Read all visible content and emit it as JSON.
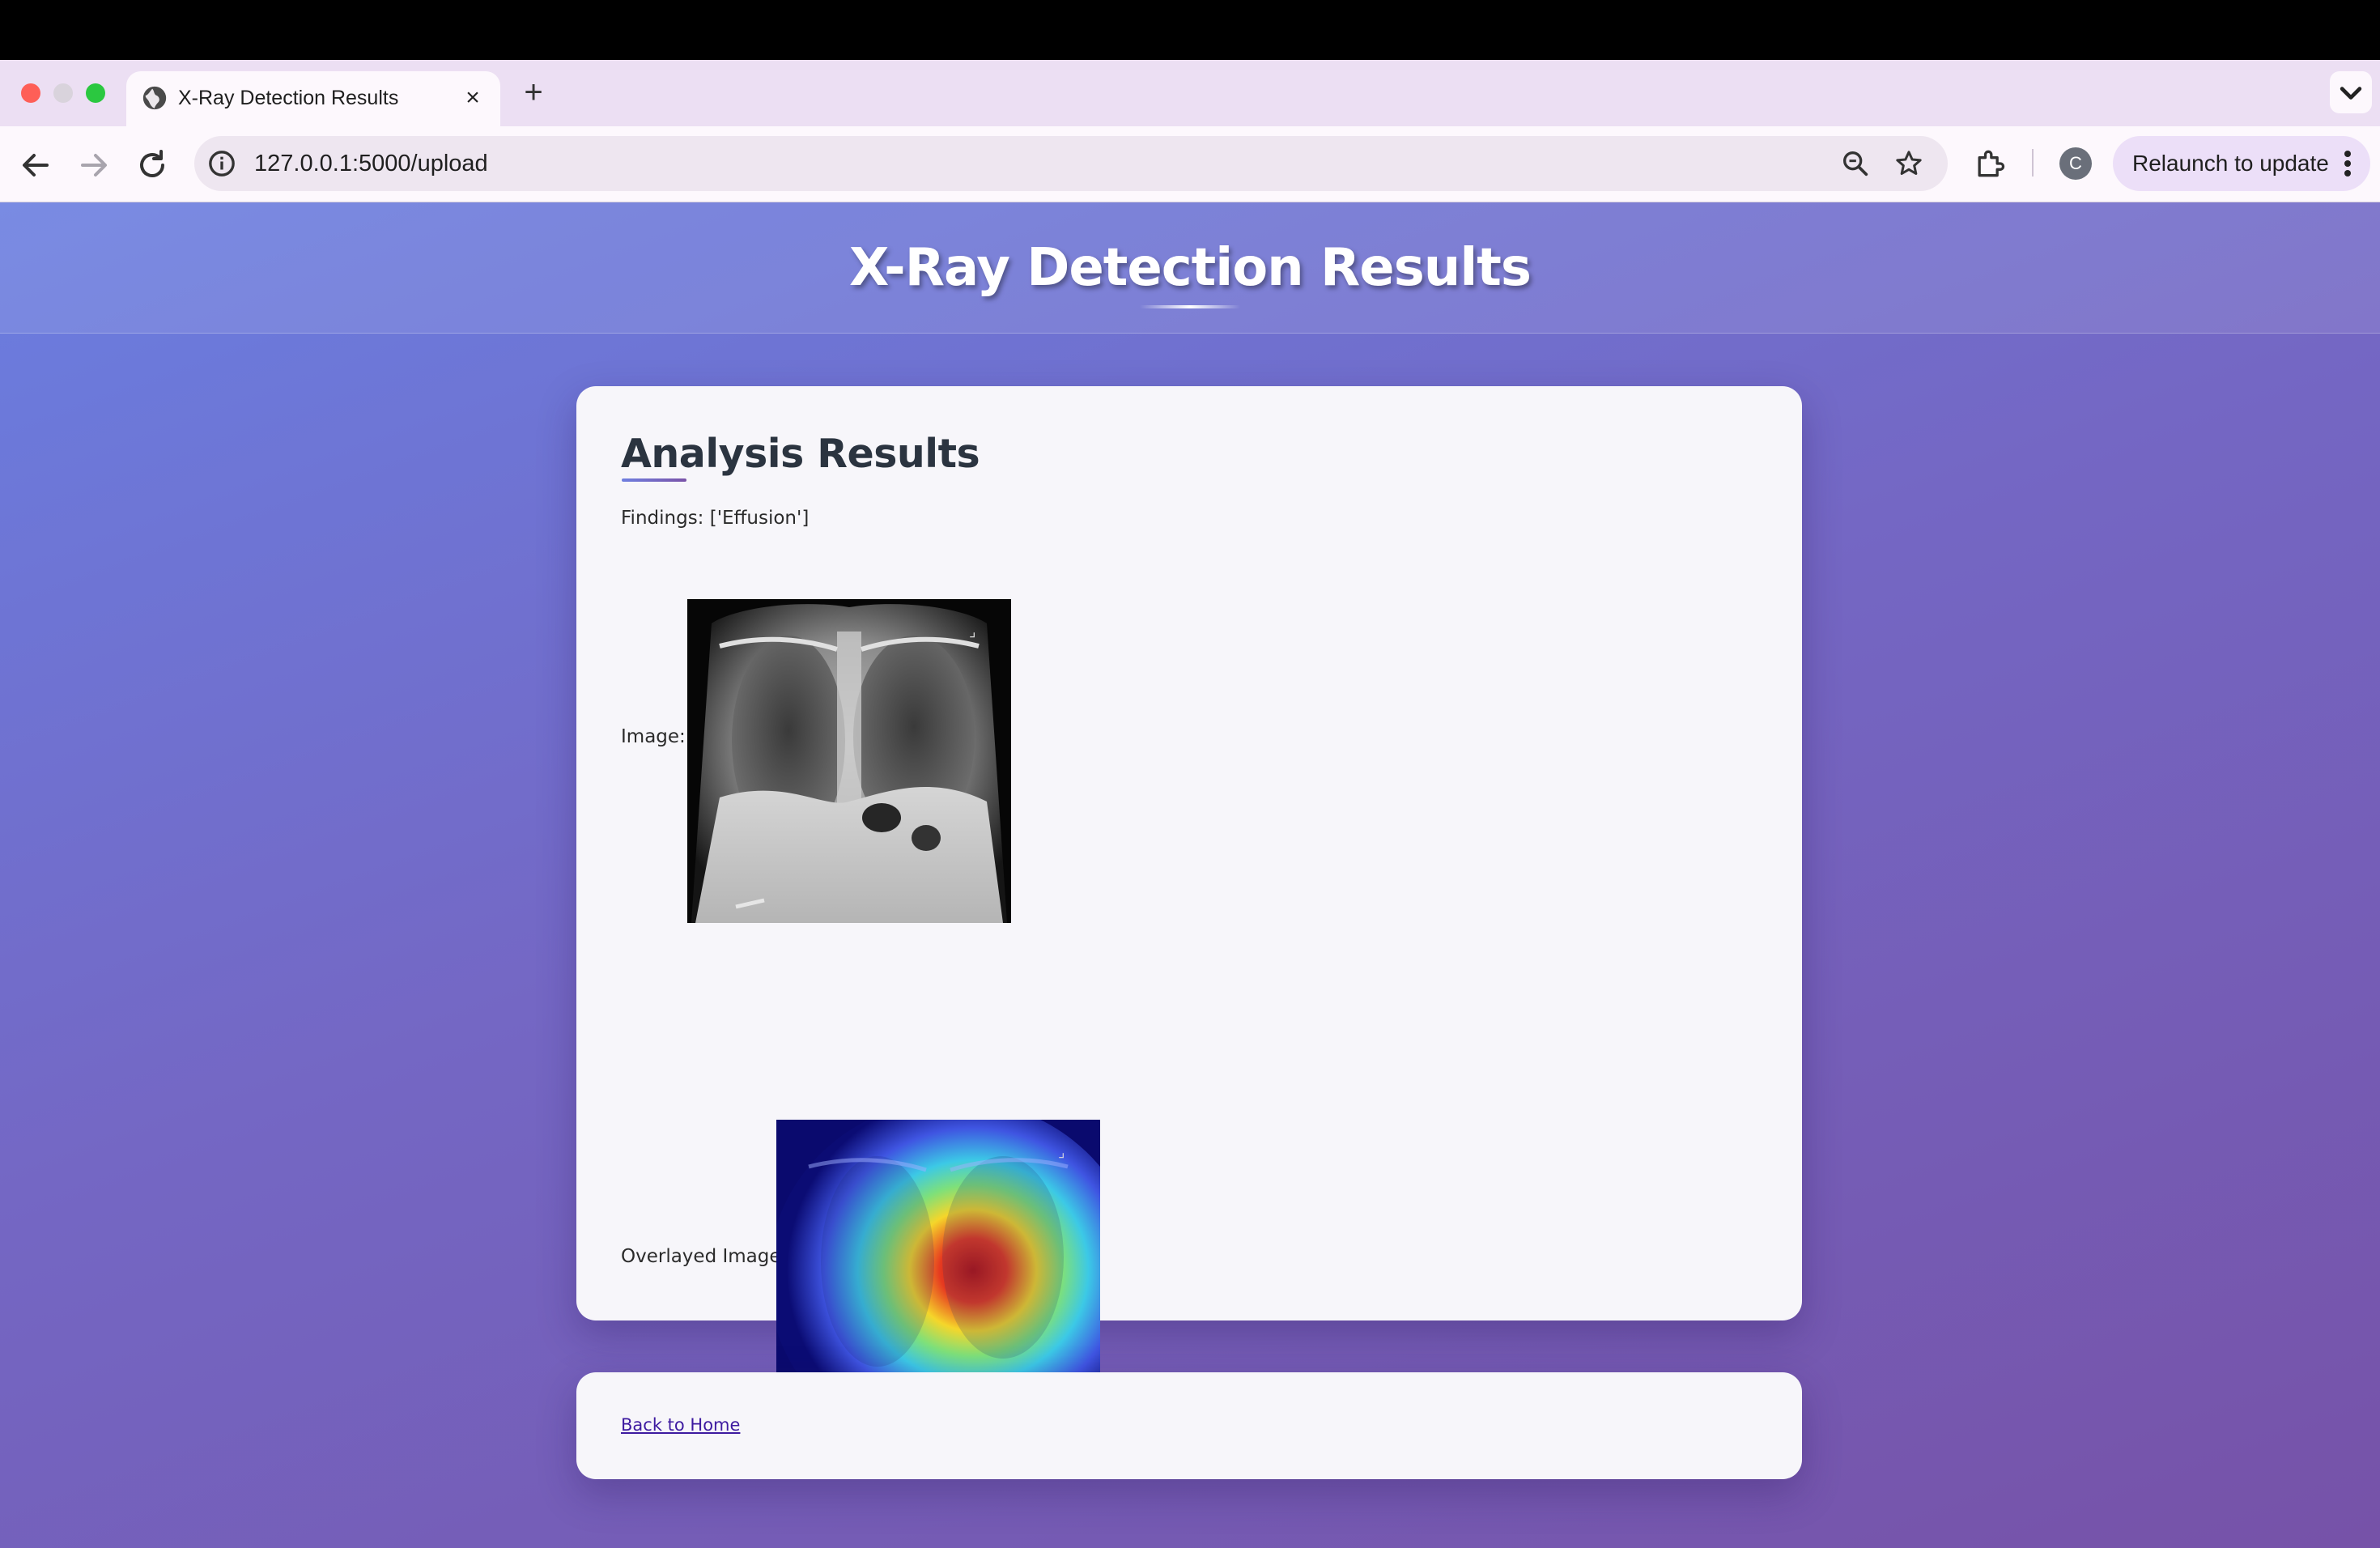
{
  "browser": {
    "tab_title": "X-Ray Detection Results",
    "tab_close": "×",
    "new_tab": "+",
    "url": "127.0.0.1:5000/upload",
    "avatar_letter": "C",
    "relaunch_label": "Relaunch to update"
  },
  "page": {
    "site_title": "X-Ray Detection Results",
    "results_heading": "Analysis Results",
    "findings": "Findings: ['Effusion']",
    "image_label": "Image:",
    "overlay_label": "Overlayed Image:",
    "back_link": "Back to Home"
  },
  "colors": {
    "gradient_start": "#6a7ee0",
    "gradient_end": "#7652a8",
    "card_background": "#f7f6fa",
    "heading_text": "#2b3440",
    "link": "#3d1aa0"
  },
  "icons": [
    "globe-icon",
    "close-icon",
    "plus-icon",
    "chevron-down-icon",
    "back-arrow-icon",
    "forward-arrow-icon",
    "reload-icon",
    "info-icon",
    "zoom-icon",
    "star-icon",
    "extensions-icon",
    "more-vert-icon"
  ]
}
